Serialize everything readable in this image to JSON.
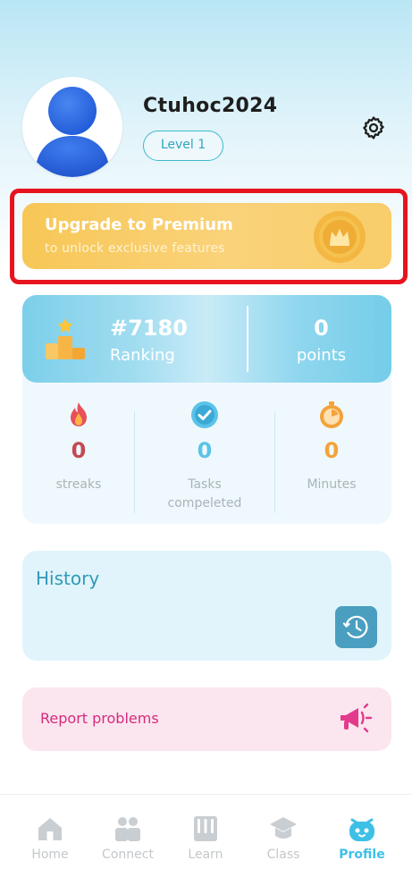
{
  "profile": {
    "username": "Ctuhoc2024",
    "level": "Level 1",
    "avatar_icon": "user-avatar-icon",
    "settings_icon": "gear-icon"
  },
  "premium": {
    "title": "Upgrade to Premium",
    "subtitle": "to unlock exclusive features",
    "icon": "crown-medal-icon",
    "highlight_color": "#e6141e"
  },
  "stats": {
    "ranking": {
      "value": "#7180",
      "label": "Ranking",
      "icon": "podium-icon"
    },
    "points": {
      "value": "0",
      "label": "points"
    },
    "items": [
      {
        "value": "0",
        "label": "streaks",
        "icon": "fire-icon",
        "color": "#c24a52"
      },
      {
        "value": "0",
        "label": "Tasks\ncompeleted",
        "icon": "check-circle-icon",
        "color": "#5cc3e8"
      },
      {
        "value": "0",
        "label": "Minutes",
        "icon": "timer-icon",
        "color": "#f3a23a"
      }
    ]
  },
  "history": {
    "title": "History",
    "icon": "clock-history-icon"
  },
  "report": {
    "label": "Report problems",
    "icon": "megaphone-icon"
  },
  "nav": {
    "items": [
      {
        "label": "Home",
        "icon": "home-icon"
      },
      {
        "label": "Connect",
        "icon": "people-icon"
      },
      {
        "label": "Learn",
        "icon": "book-icon"
      },
      {
        "label": "Class",
        "icon": "graduation-cap-icon"
      },
      {
        "label": "Profile",
        "icon": "robot-face-icon",
        "active": true
      }
    ]
  }
}
